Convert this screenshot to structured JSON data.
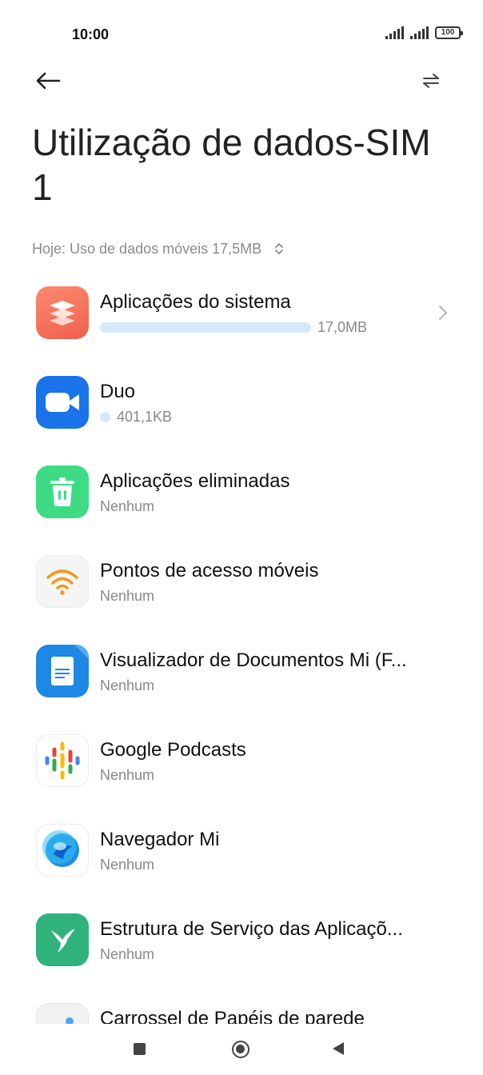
{
  "status_bar": {
    "time": "10:00",
    "battery": "100"
  },
  "header": {
    "title": "Utilização de dados-SIM 1",
    "back_icon": "arrow-left-icon",
    "switch_icon": "swap-arrows-icon"
  },
  "period": {
    "label": "Hoje: Uso de dados móveis 17,5MB",
    "selector_icon": "up-down-chevron-icon"
  },
  "usage_accent": "#d6e8fb",
  "apps": [
    {
      "name": "Aplicações do sistema",
      "usage": "17,0MB",
      "icon": "system-apps-layers-icon",
      "usage_fraction": 0.97
    },
    {
      "name": "Duo",
      "usage": "401,1KB",
      "icon": "duo-video-camera-icon",
      "usage_fraction": 0.02
    },
    {
      "name": "Aplicações eliminadas",
      "usage": "Nenhum",
      "icon": "trash-icon"
    },
    {
      "name": "Pontos de acesso móveis",
      "usage": "Nenhum",
      "icon": "wifi-hotspot-icon"
    },
    {
      "name": "Visualizador de Documentos Mi (F...",
      "usage": "Nenhum",
      "icon": "document-viewer-icon"
    },
    {
      "name": "Google Podcasts",
      "usage": "Nenhum",
      "icon": "google-podcasts-icon"
    },
    {
      "name": "Navegador Mi",
      "usage": "Nenhum",
      "icon": "mi-browser-icon"
    },
    {
      "name": "Estrutura de Serviço das Aplicaçõ...",
      "usage": "Nenhum",
      "icon": "hummingbird-icon"
    },
    {
      "name": "Carrossel de Papéis de parede",
      "usage": "",
      "icon": "wallpaper-carousel-icon"
    }
  ],
  "nav": {
    "recents": "recents-square-icon",
    "home": "home-circle-icon",
    "back": "back-triangle-icon"
  }
}
